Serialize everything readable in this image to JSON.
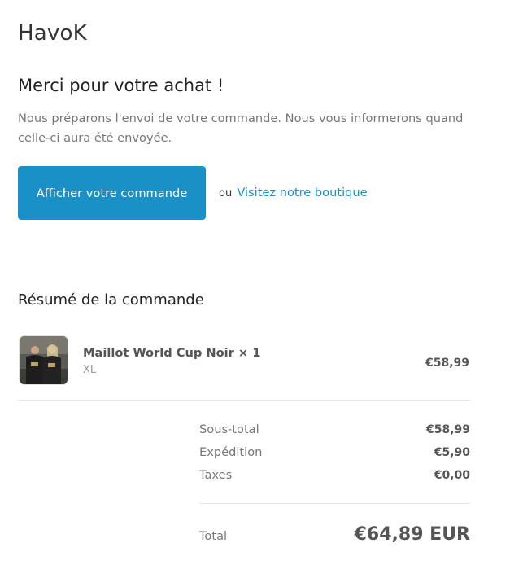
{
  "shop": {
    "name": "HavoK"
  },
  "confirmation": {
    "heading": "Merci pour votre achat !",
    "message": "Nous préparons l'envoi de votre commande. Nous vous informerons quand celle-ci aura été envoyée.",
    "view_order_label": "Afficher votre commande",
    "or_text": "ou",
    "visit_store_label": "Visitez notre boutique",
    "accent_color": "#1990c6"
  },
  "summary": {
    "title": "Résumé de la commande",
    "items": [
      {
        "name": "Maillot World Cup Noir × 1",
        "variant": "XL",
        "price": "€58,99"
      }
    ],
    "subtotal_label": "Sous-total",
    "subtotal_value": "€58,99",
    "shipping_label": "Expédition",
    "shipping_value": "€5,90",
    "taxes_label": "Taxes",
    "taxes_value": "€0,00",
    "total_label": "Total",
    "total_value": "€64,89 EUR"
  }
}
